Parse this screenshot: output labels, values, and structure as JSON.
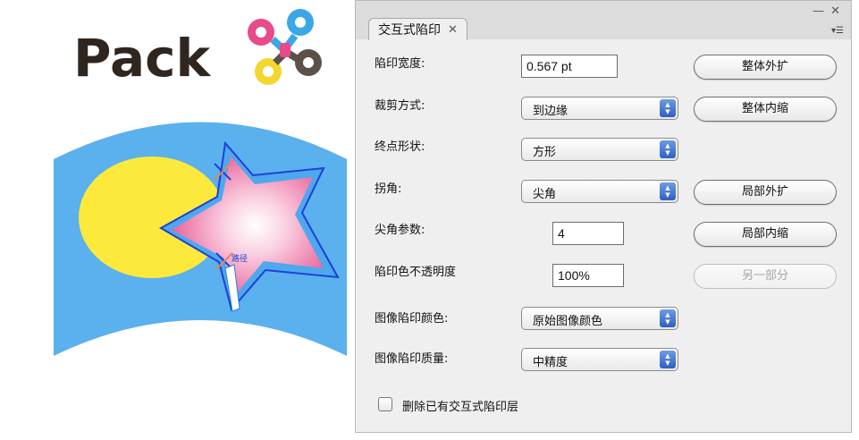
{
  "artwork": {
    "logo_text": "Pack",
    "star_label": "路径",
    "colors": {
      "background_shape": "#5bb0ee",
      "ellipse": "#fde93c",
      "star_outer": "#f06aa0",
      "star_center": "#ffffff",
      "outline": "#1f3fd6",
      "logo_text": "#2f2620"
    }
  },
  "panel": {
    "tab_label": "交互式陷印",
    "tab_close": "✕",
    "window_minimize": "—",
    "window_close": "✕",
    "menu_icon": "▾☰",
    "fields": {
      "trap_width": {
        "label": "陷印宽度:",
        "value": "0.567 pt"
      },
      "clip_mode": {
        "label": "裁剪方式:",
        "value": "到边缘"
      },
      "end_shape": {
        "label": "终点形状:",
        "value": "方形"
      },
      "corner": {
        "label": "拐角:",
        "value": "尖角"
      },
      "miter_param": {
        "label": "尖角参数:",
        "value": "4"
      },
      "trap_opacity": {
        "label": "陷印色不透明度",
        "value": "100%"
      },
      "image_trap_color": {
        "label": "图像陷印颜色:",
        "value": "原始图像颜色"
      },
      "image_trap_quality": {
        "label": "图像陷印质量:",
        "value": "中精度"
      }
    },
    "buttons": {
      "expand_all": "整体外扩",
      "shrink_all": "整体内缩",
      "expand_local": "局部外扩",
      "shrink_local": "局部内缩",
      "other_part": "另一部分"
    },
    "checkbox": {
      "label": "删除已有交互式陷印层",
      "checked": false
    },
    "arrow_glyphs": "▲▼"
  }
}
